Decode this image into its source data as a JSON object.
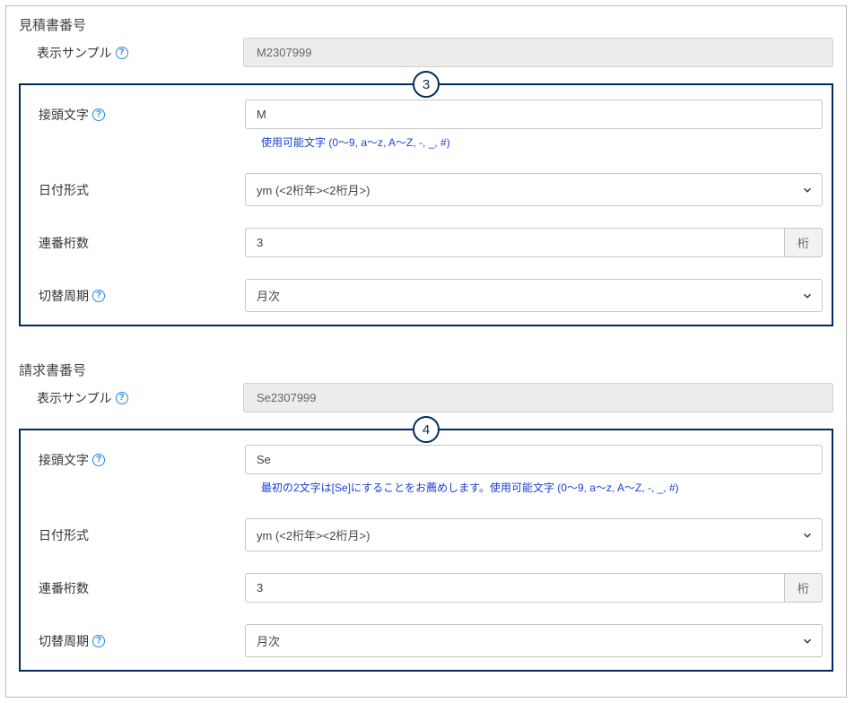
{
  "sections": [
    {
      "title": "見積書番号",
      "badge": "3",
      "sample_label": "表示サンプル",
      "sample_value": "M2307999",
      "prefix_label": "接頭文字",
      "prefix_value": "M",
      "prefix_hint": "使用可能文字 (0～9, a～z, A～Z, -, _, #)",
      "date_label": "日付形式",
      "date_value": "ym (<2桁年><2桁月>)",
      "digits_label": "連番桁数",
      "digits_value": "3",
      "digits_unit": "桁",
      "cycle_label": "切替周期",
      "cycle_value": "月次"
    },
    {
      "title": "請求書番号",
      "badge": "4",
      "sample_label": "表示サンプル",
      "sample_value": "Se2307999",
      "prefix_label": "接頭文字",
      "prefix_value": "Se",
      "prefix_hint": "最初の2文字は[Se]にすることをお薦めします。使用可能文字 (0～9, a～z, A～Z, -, _, #)",
      "date_label": "日付形式",
      "date_value": "ym (<2桁年><2桁月>)",
      "digits_label": "連番桁数",
      "digits_value": "3",
      "digits_unit": "桁",
      "cycle_label": "切替周期",
      "cycle_value": "月次"
    }
  ]
}
